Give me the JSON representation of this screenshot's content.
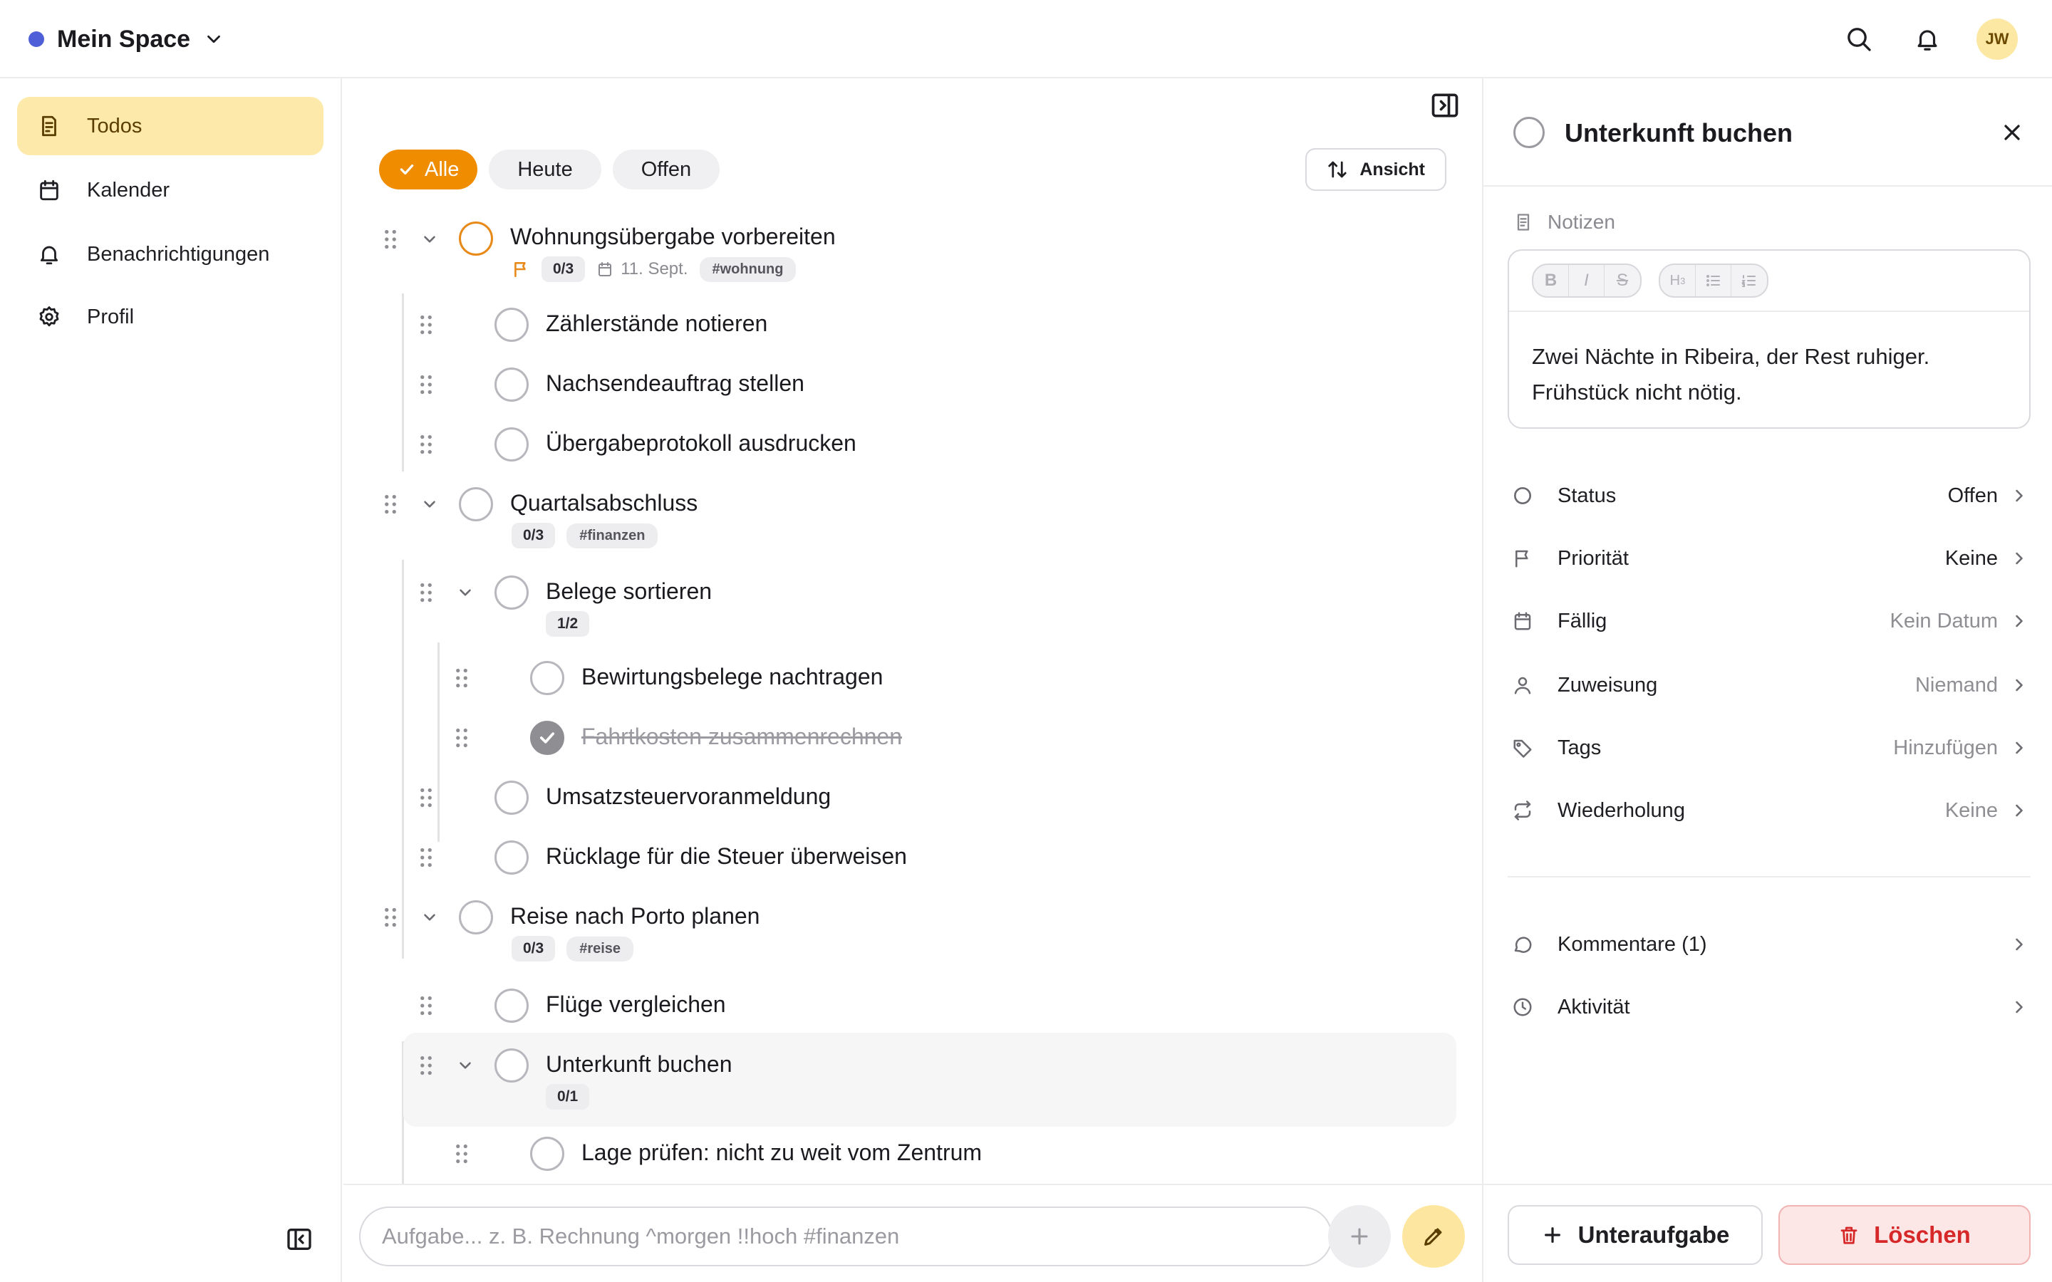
{
  "topbar": {
    "space_name": "Mein Space",
    "avatar_initials": "JW"
  },
  "sidebar": {
    "items": [
      {
        "label": "Todos",
        "icon": "todo-list-icon",
        "active": true
      },
      {
        "label": "Kalender",
        "icon": "calendar-icon"
      },
      {
        "label": "Benachrichtigungen",
        "icon": "bell-icon"
      },
      {
        "label": "Profil",
        "icon": "gear-icon"
      }
    ]
  },
  "filters": {
    "all": "Alle",
    "today": "Heute",
    "open": "Offen",
    "view": "Ansicht"
  },
  "tasks": [
    {
      "title": "Wohnungsübergabe vorbereiten",
      "progress": "0/3",
      "date": "11. Sept.",
      "tag": "#wohnung"
    },
    {
      "title": "Zählerstände notieren"
    },
    {
      "title": "Nachsendeauftrag stellen"
    },
    {
      "title": "Übergabeprotokoll ausdrucken"
    },
    {
      "title": "Quartalsabschluss",
      "progress": "0/3",
      "tag": "#finanzen"
    },
    {
      "title": "Belege sortieren",
      "progress": "1/2"
    },
    {
      "title": "Bewirtungsbelege nachtragen"
    },
    {
      "title": "Fahrtkosten zusammenrechnen",
      "done": true
    },
    {
      "title": "Umsatzsteuervoranmeldung"
    },
    {
      "title": "Rücklage für die Steuer überweisen"
    },
    {
      "title": "Reise nach Porto planen",
      "progress": "0/3",
      "tag": "#reise"
    },
    {
      "title": "Flüge vergleichen"
    },
    {
      "title": "Unterkunft buchen",
      "progress": "0/1"
    },
    {
      "title": "Lage prüfen: nicht zu weit vom Zentrum"
    }
  ],
  "input": {
    "placeholder": "Aufgabe... z. B. Rechnung ^morgen !!hoch #finanzen"
  },
  "detail": {
    "title": "Unterkunft buchen",
    "notes_label": "Notizen",
    "notes_text": "Zwei Nächte in Ribeira, der Rest ruhiger. Frühstück nicht nötig.",
    "props": [
      {
        "label": "Status",
        "value": "Offen"
      },
      {
        "label": "Priorität",
        "value": "Keine"
      },
      {
        "label": "Fällig",
        "value": "Kein Datum"
      },
      {
        "label": "Zuweisung",
        "value": "Niemand"
      },
      {
        "label": "Tags",
        "value": "Hinzufügen"
      },
      {
        "label": "Wiederholung",
        "value": "Keine"
      }
    ],
    "comments": "Kommentare (1)",
    "activity": "Aktivität",
    "add_subtask": "Unteraufgabe",
    "delete": "Löschen"
  },
  "colors": {
    "accent": "#f08c00",
    "active_nav": "#fdeaaa",
    "space_dot": "#4f5fd8",
    "danger": "#d62828"
  }
}
